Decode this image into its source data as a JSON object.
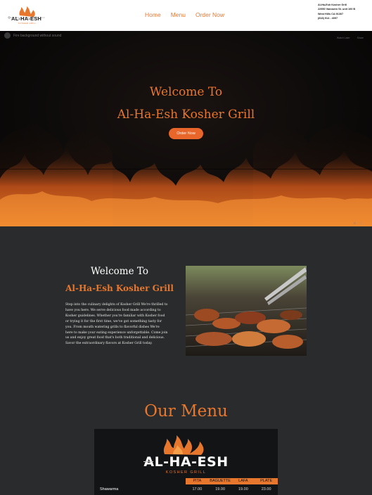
{
  "header": {
    "logo_text": "AL-HA-ESH",
    "logo_sub": "KOSHER GRILL",
    "nav": [
      "Home",
      "Menu",
      "Order Now"
    ],
    "address": [
      "Al-Ha-Esh Kosher Grill",
      "22950 Vanowen St. unit 100 B",
      "West Hills CA 91307",
      "(818) 914 - 4097"
    ]
  },
  "hero": {
    "video_title": "Fire background without sound",
    "video_controls": [
      "Watch Later",
      "Share"
    ],
    "title_line1": "Welcome To",
    "title_line2": "Al-Ha-Esh Kosher Grill",
    "cta_label": "Order Now"
  },
  "about": {
    "heading1": "Welcome To",
    "heading2": "Al-Ha-Esh Kosher Grill",
    "paragraph_lines": [
      "Step into the culinary delights of Kosher Grill We're thrilled to",
      "have you here. We serve delicious food made according to",
      "Kosher guidelines. Whether you're familiar with Kosher food",
      "or trying it for the first time, we've got something tasty for",
      "you. From mouth watering grills to flavorful dishes We're",
      "here to make your eating experience unforgettable. Come join",
      "us and enjoy great food that's both traditional and delicious.",
      "Savor the extraordinary flavors at Kosher Grill today."
    ]
  },
  "menu": {
    "title": "Our Menu",
    "board_brand": "AL-HA-ESH",
    "board_sub": "KOSHER GRILL",
    "columns": [
      "PITA",
      "BAGUETTE",
      "LAFA",
      "PLATE"
    ],
    "rows": [
      {
        "name": "Shawarma",
        "prices": [
          "17.00",
          "19.00",
          "19.00",
          "23.00"
        ]
      }
    ]
  },
  "colors": {
    "accent": "#e8772e",
    "dark_bg": "#2a2b2c"
  }
}
